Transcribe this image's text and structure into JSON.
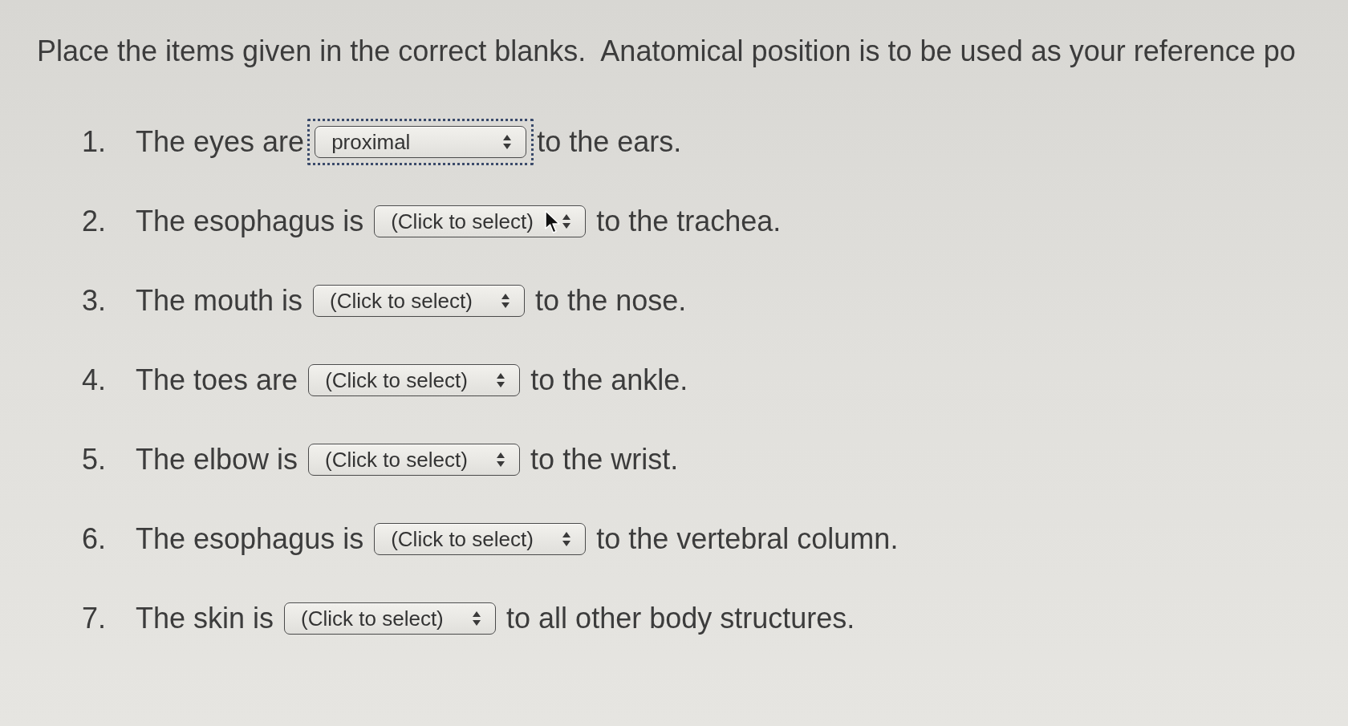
{
  "instructions": "Place the items given in the correct blanks.  Anatomical position is to be used as your reference po",
  "questions": [
    {
      "number": "1.",
      "before": "The eyes are",
      "blank": {
        "value": "proximal",
        "focused": true,
        "hovered": false
      },
      "after": "to the ears."
    },
    {
      "number": "2.",
      "before": "The esophagus is",
      "blank": {
        "value": "(Click to select)",
        "focused": false,
        "hovered": true
      },
      "after": "to the trachea."
    },
    {
      "number": "3.",
      "before": "The mouth is",
      "blank": {
        "value": "(Click to select)",
        "focused": false,
        "hovered": false
      },
      "after": "to the nose."
    },
    {
      "number": "4.",
      "before": "The toes are",
      "blank": {
        "value": "(Click to select)",
        "focused": false,
        "hovered": false
      },
      "after": "to the ankle."
    },
    {
      "number": "5.",
      "before": "The elbow is",
      "blank": {
        "value": "(Click to select)",
        "focused": false,
        "hovered": false
      },
      "after": "to the wrist."
    },
    {
      "number": "6.",
      "before": "The esophagus is",
      "blank": {
        "value": "(Click to select)",
        "focused": false,
        "hovered": false
      },
      "after": "to the vertebral column."
    },
    {
      "number": "7.",
      "before": "The skin is",
      "blank": {
        "value": "(Click to select)",
        "focused": false,
        "hovered": false
      },
      "after": "to all other body structures."
    }
  ]
}
